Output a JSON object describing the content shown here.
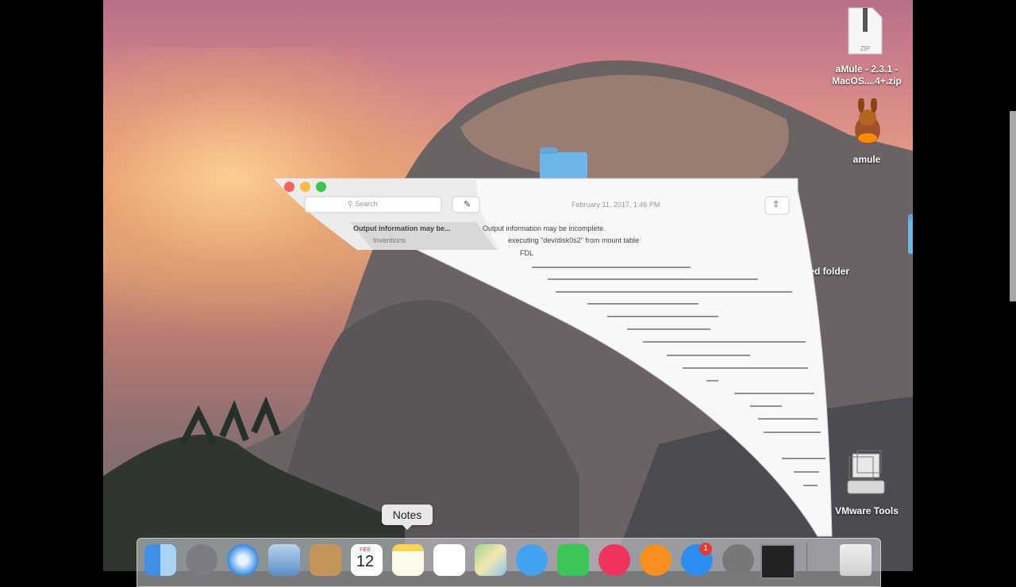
{
  "desktop": {
    "zip_file_label_line1": "aMule - 2.3.1 -",
    "zip_file_label_line2": "MacOS....4+.zip",
    "zip_badge": "ZIP",
    "app_label": "amule",
    "folder_label": "tled folder",
    "vmware_label": "VMware Tools"
  },
  "notes_window": {
    "search_placeholder": "Search",
    "date": "February 11, 2017, 1:46 PM",
    "list_item_title": "Output information may be...",
    "list_item_sub": "Inventions",
    "body_line1": "Output information may be incomplete.",
    "body_line2": "executing \"dev/disk0s2\" from mount table",
    "body_line3": "FDL"
  },
  "tooltip": "Notes",
  "dock": {
    "calendar_month": "FEB",
    "calendar_day": "12",
    "appstore_badge": "1",
    "items": [
      "Finder",
      "Launchpad",
      "Safari",
      "Mail",
      "Contacts",
      "Calendar",
      "Notes",
      "Reminders",
      "Maps",
      "Messages",
      "FaceTime",
      "iTunes",
      "iBooks",
      "App Store",
      "System Preferences",
      "Activity Monitor",
      "Trash"
    ]
  },
  "colors": {
    "folder": "#6eb6ea",
    "close": "#fc605b",
    "minimize": "#fdbc40",
    "zoom": "#34c84a"
  }
}
